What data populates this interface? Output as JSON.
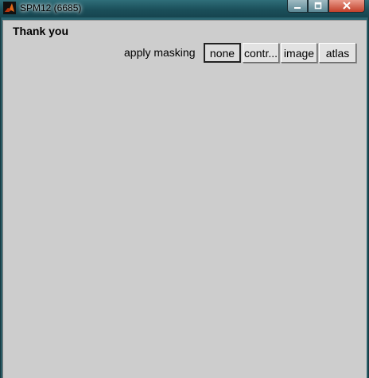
{
  "window": {
    "title": "SPM12 (6685)",
    "controls": {
      "minimize_icon": "minimize-icon",
      "maximize_icon": "maximize-icon",
      "close_icon": "close-icon"
    }
  },
  "content": {
    "heading": "Thank you",
    "masking": {
      "label": "apply masking",
      "options": [
        "none",
        "contr...",
        "image",
        "atlas"
      ],
      "selected": "none"
    }
  },
  "colors": {
    "panel": "#cdcdcd",
    "titlebar": "#1b4f5a",
    "close_button": "#c2402a"
  }
}
